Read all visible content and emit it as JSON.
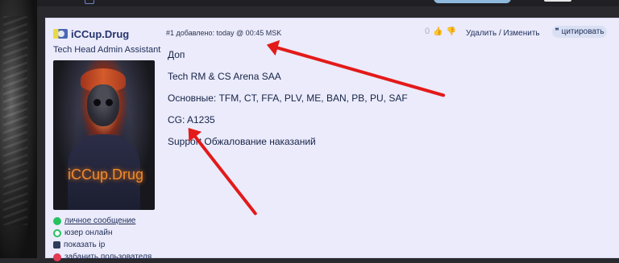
{
  "user": {
    "name": "iCCup.Drug",
    "title": "Tech Head Admin Assistant",
    "avatar_text": "iCCup.Drug",
    "links": [
      {
        "label": "личное сообщение",
        "icon": "message-icon"
      },
      {
        "label": "юзер онлайн",
        "icon": "online-icon"
      },
      {
        "label": "показать ip",
        "icon": "ip-icon"
      },
      {
        "label": "забанить пользователя",
        "icon": "ban-icon"
      }
    ]
  },
  "post": {
    "meta": "#1 добавлено: today @ 00:45 MSK",
    "likes_count": "0",
    "delete_label": "Удалить",
    "separator": "/",
    "edit_label": "Изменить",
    "quote_label": "цитировать",
    "lines": [
      "Доп",
      "Tech RM & CS Arena SAA",
      "Основные: TFM, CT, FFA, PLV, ME, BAN, PB, PU, SAF",
      "CG: A1235",
      "Support Обжалование наказаний"
    ]
  },
  "colors": {
    "panel_bg": "#ebebfb",
    "accent": "#27346e",
    "arrow": "#e31a1a"
  }
}
